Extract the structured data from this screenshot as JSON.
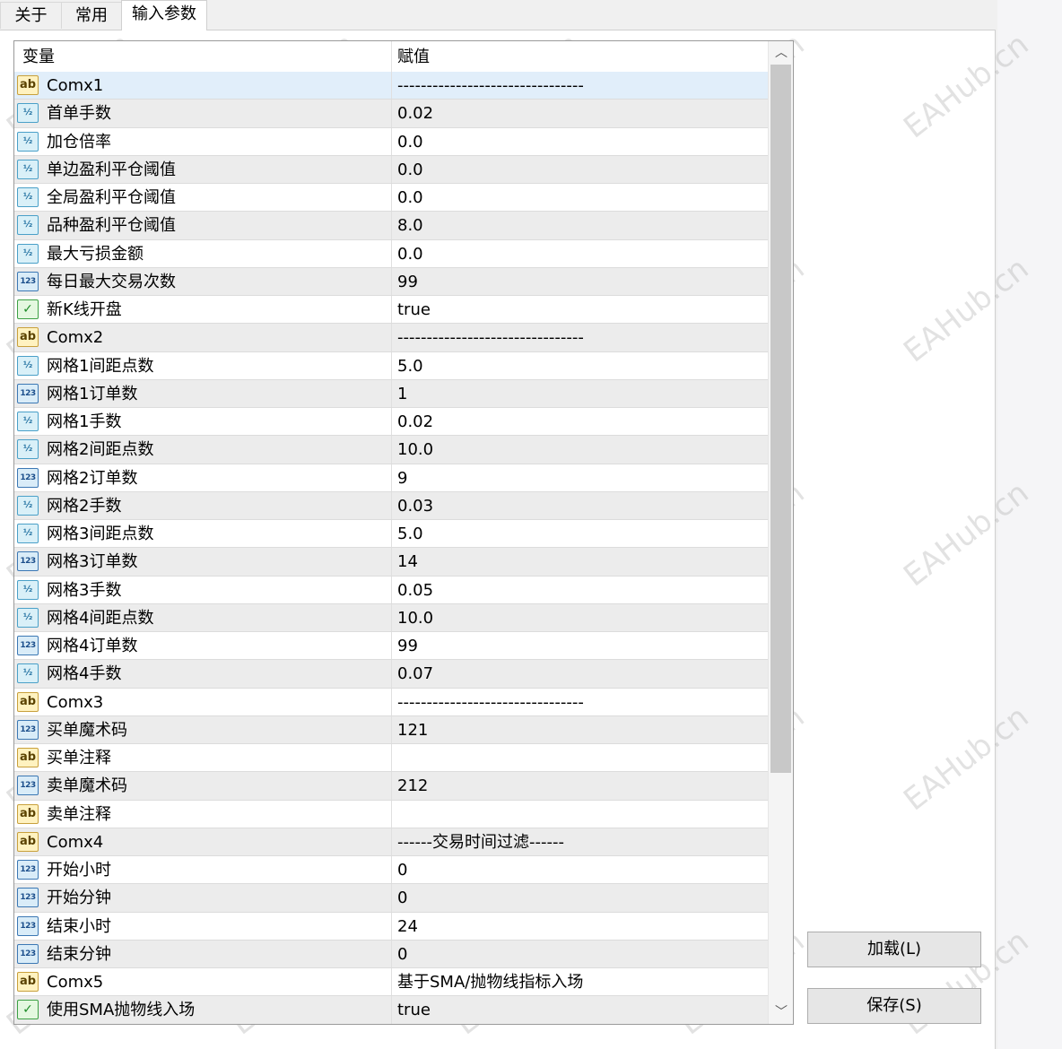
{
  "tabs": [
    {
      "label": "关于",
      "active": false
    },
    {
      "label": "常用",
      "active": false
    },
    {
      "label": "输入参数",
      "active": true
    }
  ],
  "table": {
    "headers": {
      "name": "变量",
      "value": "赋值"
    },
    "selected_row": 0,
    "rows": [
      {
        "icon": "ab-string-icon",
        "name": "Comx1",
        "value": "--------------------------------"
      },
      {
        "icon": "double-icon",
        "name": "首单手数",
        "value": "0.02"
      },
      {
        "icon": "double-icon",
        "name": "加仓倍率",
        "value": "0.0"
      },
      {
        "icon": "double-icon",
        "name": "单边盈利平仓阈值",
        "value": "0.0"
      },
      {
        "icon": "double-icon",
        "name": "全局盈利平仓阈值",
        "value": "0.0"
      },
      {
        "icon": "double-icon",
        "name": "品种盈利平仓阈值",
        "value": "8.0"
      },
      {
        "icon": "double-icon",
        "name": "最大亏损金额",
        "value": "0.0"
      },
      {
        "icon": "integer-icon",
        "name": "每日最大交易次数",
        "value": "99"
      },
      {
        "icon": "bool-icon",
        "name": "新K线开盘",
        "value": "true"
      },
      {
        "icon": "ab-string-icon",
        "name": "Comx2",
        "value": "--------------------------------"
      },
      {
        "icon": "double-icon",
        "name": "网格1间距点数",
        "value": "5.0"
      },
      {
        "icon": "integer-icon",
        "name": "网格1订单数",
        "value": "1"
      },
      {
        "icon": "double-icon",
        "name": "网格1手数",
        "value": "0.02"
      },
      {
        "icon": "double-icon",
        "name": "网格2间距点数",
        "value": "10.0"
      },
      {
        "icon": "integer-icon",
        "name": "网格2订单数",
        "value": "9"
      },
      {
        "icon": "double-icon",
        "name": "网格2手数",
        "value": "0.03"
      },
      {
        "icon": "double-icon",
        "name": "网格3间距点数",
        "value": "5.0"
      },
      {
        "icon": "integer-icon",
        "name": "网格3订单数",
        "value": "14"
      },
      {
        "icon": "double-icon",
        "name": "网格3手数",
        "value": "0.05"
      },
      {
        "icon": "double-icon",
        "name": "网格4间距点数",
        "value": "10.0"
      },
      {
        "icon": "integer-icon",
        "name": "网格4订单数",
        "value": "99"
      },
      {
        "icon": "double-icon",
        "name": "网格4手数",
        "value": "0.07"
      },
      {
        "icon": "ab-string-icon",
        "name": "Comx3",
        "value": "--------------------------------"
      },
      {
        "icon": "integer-icon",
        "name": "买单魔术码",
        "value": "121"
      },
      {
        "icon": "ab-string-icon",
        "name": "买单注释",
        "value": ""
      },
      {
        "icon": "integer-icon",
        "name": "卖单魔术码",
        "value": "212"
      },
      {
        "icon": "ab-string-icon",
        "name": "卖单注释",
        "value": ""
      },
      {
        "icon": "ab-string-icon",
        "name": "Comx4",
        "value": "------交易时间过滤------"
      },
      {
        "icon": "integer-icon",
        "name": "开始小时",
        "value": "0"
      },
      {
        "icon": "integer-icon",
        "name": "开始分钟",
        "value": "0"
      },
      {
        "icon": "integer-icon",
        "name": "结束小时",
        "value": "24"
      },
      {
        "icon": "integer-icon",
        "name": "结束分钟",
        "value": "0"
      },
      {
        "icon": "ab-string-icon",
        "name": "Comx5",
        "value": "基于SMA/抛物线指标入场"
      },
      {
        "icon": "bool-icon",
        "name": "使用SMA抛物线入场",
        "value": "true"
      }
    ]
  },
  "icon_glyphs": {
    "ab-string-icon": "ab",
    "double-icon": "½",
    "integer-icon": "123",
    "bool-icon": "✓"
  },
  "scrollbar": {
    "up_icon": "︿",
    "down_icon": "﹀"
  },
  "buttons": {
    "load": "加载(L)",
    "save": "保存(S)"
  },
  "watermark": {
    "text": "EAHub.cn"
  }
}
